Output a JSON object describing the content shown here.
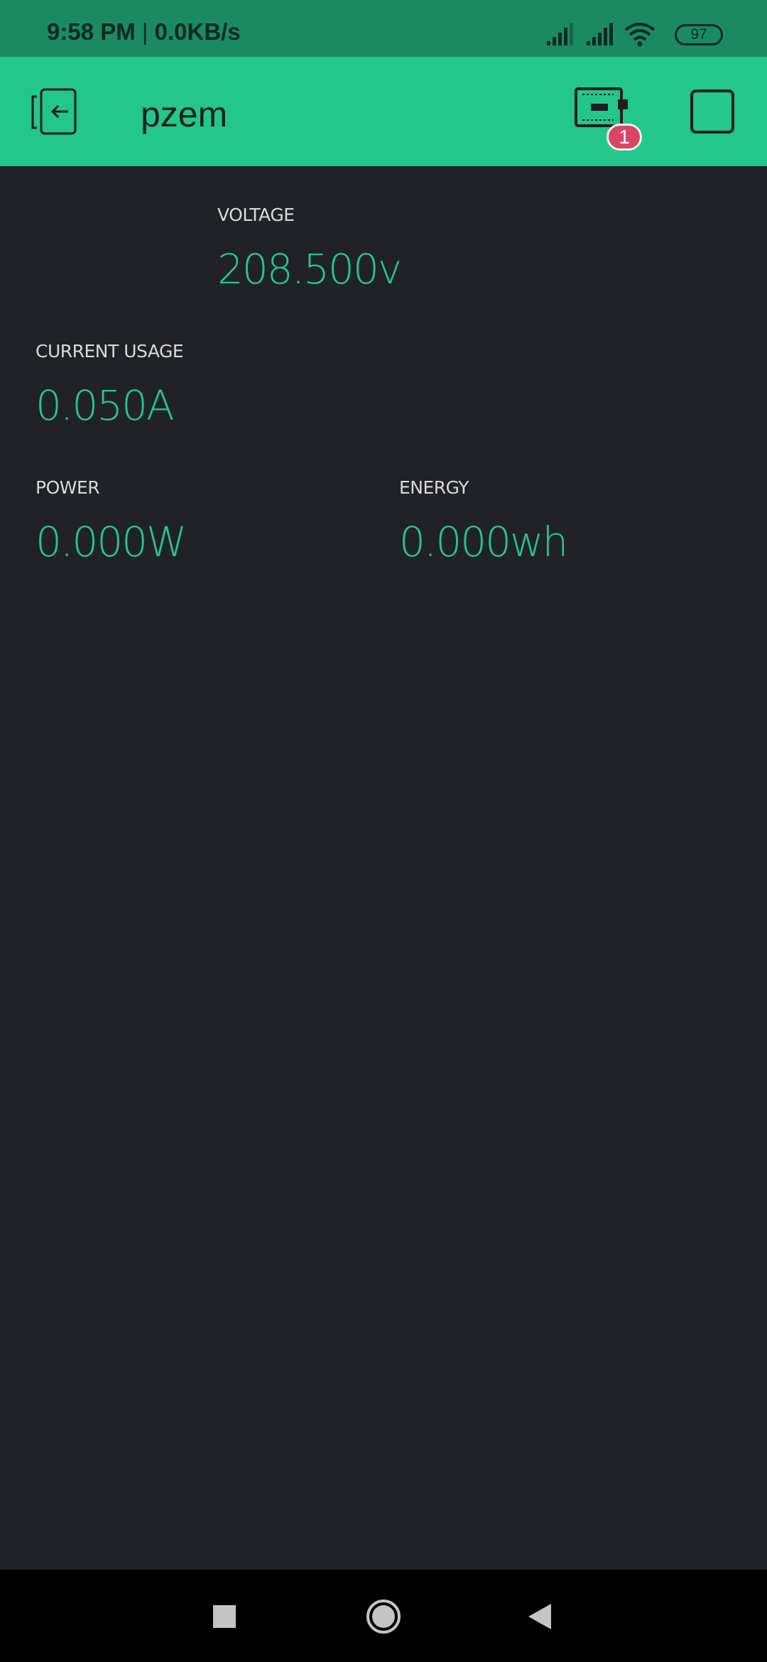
{
  "status_bar": {
    "time": "9:58 PM",
    "separator": "|",
    "net_speed": "0.0KB/s",
    "battery": "97",
    "icons": [
      "signal-icon",
      "signal-icon",
      "wifi-icon",
      "battery-icon"
    ]
  },
  "app_bar": {
    "title": "pzem",
    "device_badge": "1",
    "icons": [
      "back-icon",
      "device-icon",
      "square-icon"
    ],
    "color": "#23c68b"
  },
  "widgets": {
    "voltage": {
      "label": "VOLTAGE",
      "value": "208.500v"
    },
    "current": {
      "label": "CURRENT USAGE",
      "value": "0.050A"
    },
    "power": {
      "label": "POWER",
      "value": "0.000W"
    },
    "energy": {
      "label": "ENERGY",
      "value": "0.000wh"
    }
  },
  "nav_bar": {
    "icons": [
      "recents-icon",
      "home-icon",
      "back-triangle-icon"
    ]
  }
}
